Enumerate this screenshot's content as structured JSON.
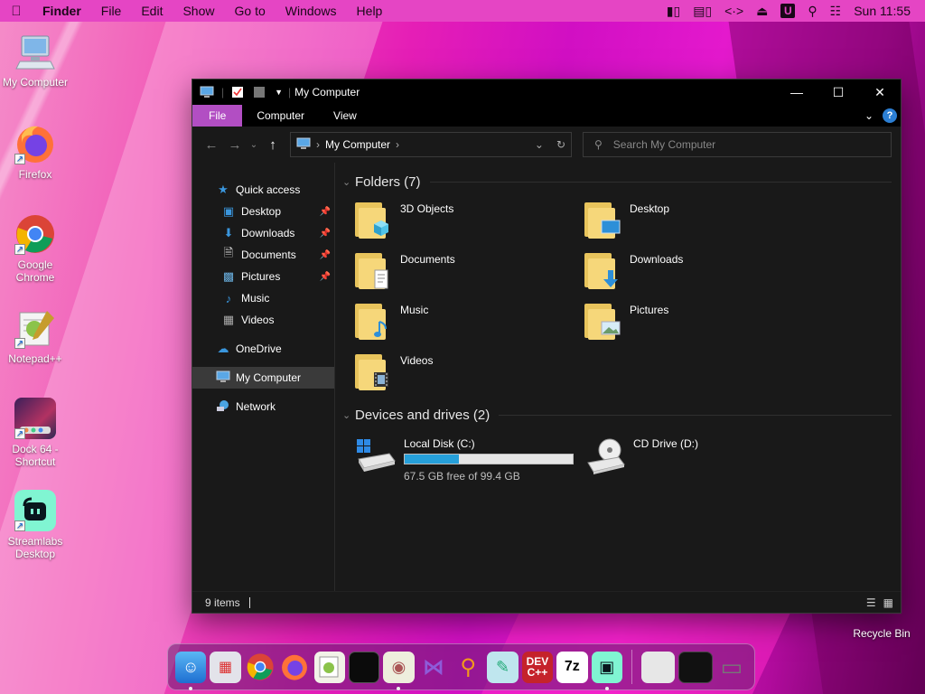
{
  "menubar": {
    "app": "Finder",
    "items": [
      "File",
      "Edit",
      "Show",
      "Go to",
      "Windows",
      "Help"
    ],
    "clock": "Sun 11:55",
    "u_icon": "U"
  },
  "desktop": {
    "icons": [
      {
        "label": "My Computer"
      },
      {
        "label": "Firefox"
      },
      {
        "label": "Google Chrome"
      },
      {
        "label": "Notepad++"
      },
      {
        "label": "Dock 64 - Shortcut"
      },
      {
        "label": "Streamlabs Desktop"
      }
    ],
    "recycle_bin": "Recycle Bin"
  },
  "window": {
    "title": "My Computer",
    "ribbon": {
      "file": "File",
      "computer": "Computer",
      "view": "View",
      "help": "?"
    },
    "address": {
      "crumb": "My Computer"
    },
    "search": {
      "placeholder": "Search My Computer"
    },
    "sidebar": {
      "quick_access": "Quick access",
      "items": [
        "Desktop",
        "Downloads",
        "Documents",
        "Pictures",
        "Music",
        "Videos"
      ],
      "onedrive": "OneDrive",
      "my_computer": "My Computer",
      "network": "Network"
    },
    "folders_header": "Folders (7)",
    "folders": [
      "3D Objects",
      "Desktop",
      "Documents",
      "Downloads",
      "Music",
      "Pictures",
      "Videos"
    ],
    "drives_header": "Devices and drives (2)",
    "drives": [
      {
        "name": "Local Disk (C:)",
        "free": "67.5 GB free of 99.4 GB",
        "used_fraction": 0.32
      },
      {
        "name": "CD Drive (D:)"
      }
    ],
    "status": "9 items"
  },
  "colors": {
    "accent": "#b24ec3",
    "progress": "#26a0da",
    "folder": "#f6d77a"
  }
}
